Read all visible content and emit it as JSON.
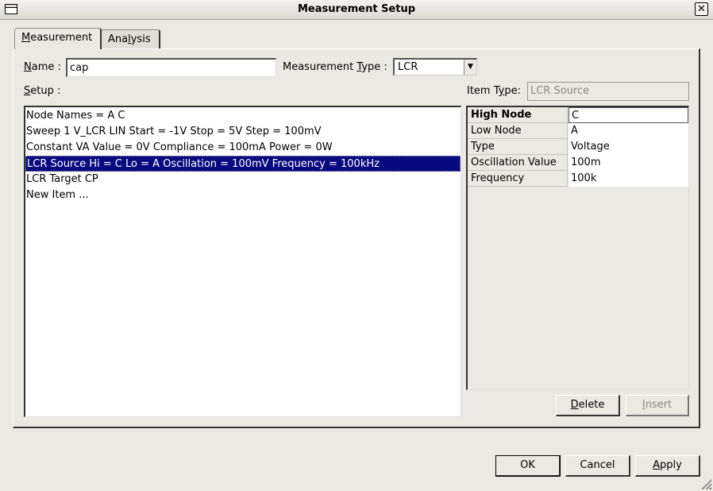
{
  "window": {
    "title": "Measurement Setup"
  },
  "tabs": {
    "measurement": {
      "first": "M",
      "rest": "easurement"
    },
    "analysis": {
      "pre": "Ana",
      "u": "l",
      "post": "ysis"
    }
  },
  "name_field": {
    "label_u": "N",
    "label_rest": "ame :",
    "value": "cap"
  },
  "measurement_type": {
    "label_pre": "Measurement ",
    "label_u": "T",
    "label_post": "ype :",
    "value": "LCR"
  },
  "setup": {
    "label_u": "S",
    "label_rest": "etup :",
    "items": [
      "Node Names = A C",
      "Sweep 1 V_LCR LIN Start = -1V Stop = 5V Step = 100mV",
      "Constant VA Value = 0V Compliance = 100mA Power = 0W",
      "LCR Source Hi = C Lo = A Oscillation = 100mV Frequency = 100kHz",
      "LCR Target CP",
      "New Item ..."
    ]
  },
  "item_type": {
    "label_pre": "Item T",
    "label_u": "y",
    "label_post": "pe:",
    "value": "LCR Source"
  },
  "properties": [
    {
      "name": "High Node",
      "value": "C"
    },
    {
      "name": "Low Node",
      "value": "A"
    },
    {
      "name": "Type",
      "value": "Voltage"
    },
    {
      "name": "Oscillation Value",
      "value": "100m"
    },
    {
      "name": "Frequency",
      "value": "100k"
    }
  ],
  "buttons": {
    "delete": {
      "u": "D",
      "rest": "elete"
    },
    "insert": {
      "u": "I",
      "rest": "nsert"
    },
    "ok": "OK",
    "cancel": "Cancel",
    "apply": {
      "u": "A",
      "rest": "pply"
    }
  },
  "colors": {
    "selection": "#0a0a80",
    "background": "#ebe9e4"
  }
}
